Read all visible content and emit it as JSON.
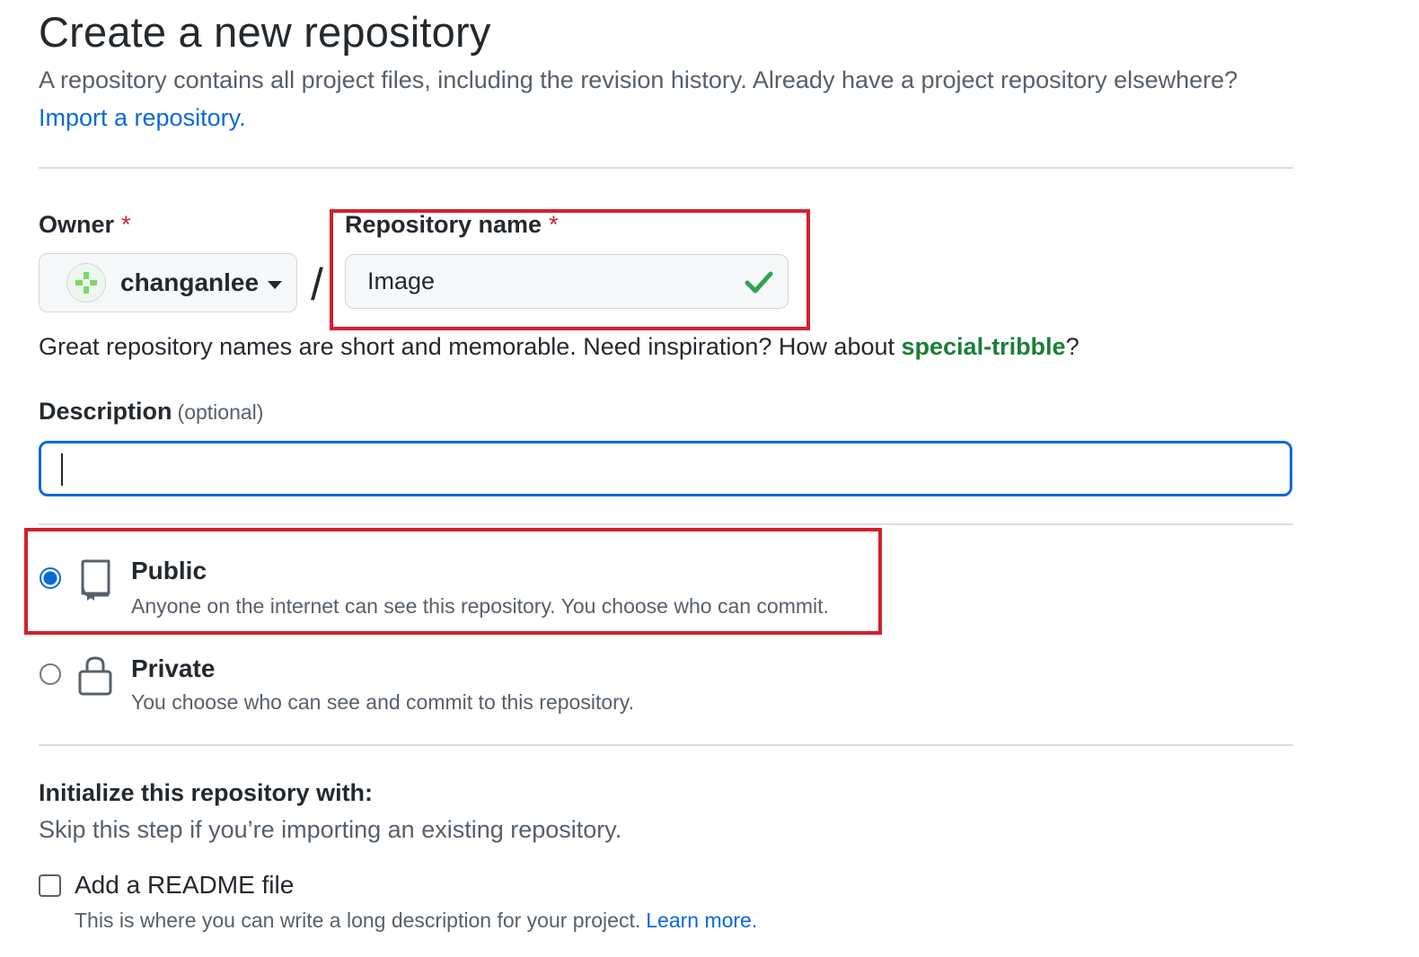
{
  "header": {
    "title": "Create a new repository",
    "subtitle": "A repository contains all project files, including the revision history. Already have a project repository elsewhere?",
    "import_link": "Import a repository."
  },
  "owner": {
    "label": "Owner",
    "required_mark": "*",
    "value": "changanlee",
    "icon": "avatar-identicon"
  },
  "separator": "/",
  "repo_name": {
    "label": "Repository name",
    "required_mark": "*",
    "value": "Image",
    "status_icon": "check-icon",
    "status_color": "#2da44e"
  },
  "name_hint": {
    "text": "Great repository names are short and memorable. Need inspiration? How about",
    "suggestion": "special-tribble",
    "suffix": "?"
  },
  "description": {
    "label": "Description",
    "optional": "(optional)",
    "value": ""
  },
  "visibility": {
    "options": [
      {
        "title": "Public",
        "description": "Anyone on the internet can see this repository. You choose who can commit.",
        "icon": "repo-icon",
        "selected": true
      },
      {
        "title": "Private",
        "description": "You choose who can see and commit to this repository.",
        "icon": "lock-icon",
        "selected": false
      }
    ]
  },
  "initialize": {
    "title": "Initialize this repository with:",
    "subtitle": "Skip this step if you’re importing an existing repository.",
    "readme": {
      "label": "Add a README file",
      "description": "This is where you can write a long description for your project.",
      "learn_more": "Learn more.",
      "checked": false
    }
  },
  "colors": {
    "link": "#0969da",
    "accent_green": "#1a7f37",
    "required": "#cf222e",
    "highlight_box": "#d4202c",
    "focus_border": "#0969da"
  }
}
